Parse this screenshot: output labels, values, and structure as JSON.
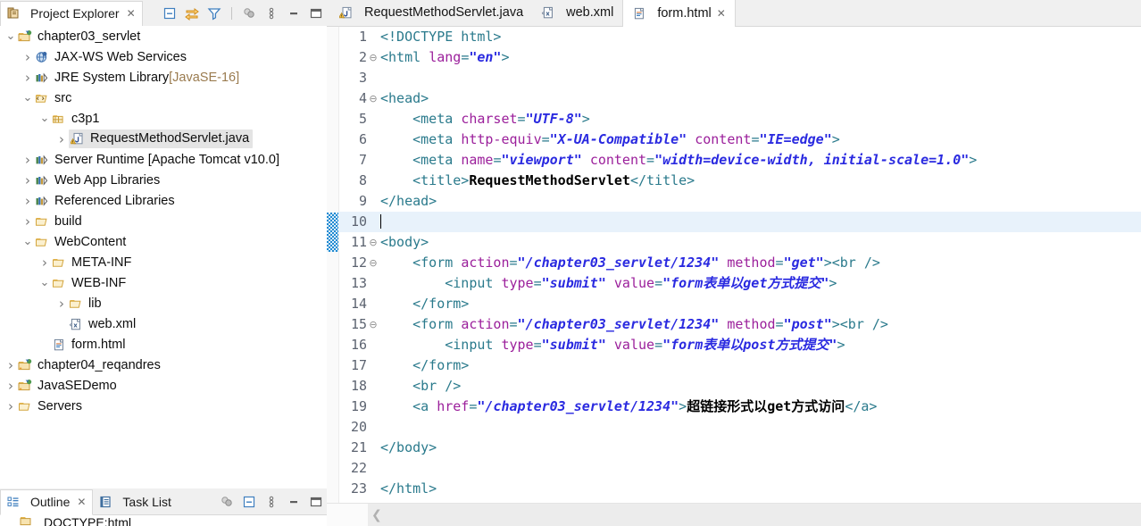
{
  "explorer": {
    "tab_label": "Project Explorer",
    "tab_close": "✕",
    "toolbar": [
      {
        "name": "collapse-all-icon",
        "title": "Collapse All"
      },
      {
        "name": "link-with-editor-icon",
        "title": "Link with Editor"
      },
      {
        "name": "filter-icon",
        "title": "Filters"
      },
      {
        "name": "view-menu-icon",
        "title": "View Menu"
      },
      {
        "name": "vertical-dots-icon",
        "title": "More"
      },
      {
        "name": "minimize-icon",
        "title": "Minimize"
      },
      {
        "name": "maximize-icon",
        "title": "Maximize"
      }
    ],
    "tree": [
      {
        "label": "chapter03_servlet",
        "indent": 0,
        "arrow": "v",
        "icon": "project-icon",
        "selected": false,
        "suffix": ""
      },
      {
        "label": "JAX-WS Web Services",
        "indent": 1,
        "arrow": ">",
        "icon": "jaxws-icon",
        "selected": false,
        "suffix": ""
      },
      {
        "label": "JRE System Library",
        "indent": 1,
        "arrow": ">",
        "icon": "library-icon",
        "selected": false,
        "suffix": " [JavaSE-16]"
      },
      {
        "label": "src",
        "indent": 1,
        "arrow": "v",
        "icon": "source-folder-icon",
        "selected": false,
        "suffix": ""
      },
      {
        "label": "c3p1",
        "indent": 2,
        "arrow": "v",
        "icon": "package-icon",
        "selected": false,
        "suffix": ""
      },
      {
        "label": "RequestMethodServlet.java",
        "indent": 3,
        "arrow": ">",
        "icon": "java-file-icon",
        "selected": true,
        "suffix": ""
      },
      {
        "label": "Server Runtime [Apache Tomcat v10.0]",
        "indent": 1,
        "arrow": ">",
        "icon": "library-icon",
        "selected": false,
        "suffix": ""
      },
      {
        "label": "Web App Libraries",
        "indent": 1,
        "arrow": ">",
        "icon": "library-icon",
        "selected": false,
        "suffix": ""
      },
      {
        "label": "Referenced Libraries",
        "indent": 1,
        "arrow": ">",
        "icon": "library-icon",
        "selected": false,
        "suffix": ""
      },
      {
        "label": "build",
        "indent": 1,
        "arrow": ">",
        "icon": "folder-icon",
        "selected": false,
        "suffix": ""
      },
      {
        "label": "WebContent",
        "indent": 1,
        "arrow": "v",
        "icon": "folder-icon",
        "selected": false,
        "suffix": ""
      },
      {
        "label": "META-INF",
        "indent": 2,
        "arrow": ">",
        "icon": "folder-icon",
        "selected": false,
        "suffix": ""
      },
      {
        "label": "WEB-INF",
        "indent": 2,
        "arrow": "v",
        "icon": "folder-icon",
        "selected": false,
        "suffix": ""
      },
      {
        "label": "lib",
        "indent": 3,
        "arrow": ">",
        "icon": "folder-icon",
        "selected": false,
        "suffix": ""
      },
      {
        "label": "web.xml",
        "indent": 3,
        "arrow": "",
        "icon": "xml-file-icon",
        "selected": false,
        "suffix": ""
      },
      {
        "label": "form.html",
        "indent": 2,
        "arrow": "",
        "icon": "html-file-icon",
        "selected": false,
        "suffix": ""
      },
      {
        "label": "chapter04_reqandres",
        "indent": 0,
        "arrow": ">",
        "icon": "project-icon",
        "selected": false,
        "suffix": ""
      },
      {
        "label": "JavaSEDemo",
        "indent": 0,
        "arrow": ">",
        "icon": "project-icon",
        "selected": false,
        "suffix": ""
      },
      {
        "label": "Servers",
        "indent": 0,
        "arrow": ">",
        "icon": "folder-icon",
        "selected": false,
        "suffix": ""
      }
    ]
  },
  "bottom_view": {
    "tabs": [
      {
        "label": "Outline",
        "icon": "outline-icon",
        "active": true,
        "close": "✕"
      },
      {
        "label": "Task List",
        "icon": "tasklist-icon",
        "active": false,
        "close": ""
      }
    ],
    "toolbar": [
      {
        "name": "view-menu-icon"
      },
      {
        "name": "collapse-all-icon"
      },
      {
        "name": "vertical-dots-icon"
      },
      {
        "name": "minimize-icon"
      },
      {
        "name": "maximize-icon"
      }
    ],
    "first_item": "DOCTYPE:html"
  },
  "editor": {
    "tabs": [
      {
        "label": "RequestMethodServlet.java",
        "icon": "java-file-icon",
        "active": false,
        "close": ""
      },
      {
        "label": "web.xml",
        "icon": "xml-file-icon",
        "active": false,
        "close": ""
      },
      {
        "label": "form.html",
        "icon": "html-file-icon",
        "active": true,
        "close": "✕"
      }
    ],
    "current_line": 10,
    "scroll_left_arrow": "❮",
    "lines": [
      {
        "n": 1,
        "fold": "",
        "html": "<span class='tag'>&lt;!DOCTYPE html&gt;</span>"
      },
      {
        "n": 2,
        "fold": "⊖",
        "html": "<span class='tag'>&lt;html </span><span class='attr'>lang</span><span class='tag'>=</span><span class='val'>\"en\"</span><span class='tag'>&gt;</span>"
      },
      {
        "n": 3,
        "fold": "",
        "html": ""
      },
      {
        "n": 4,
        "fold": "⊖",
        "html": "<span class='tag'>&lt;head&gt;</span>"
      },
      {
        "n": 5,
        "fold": "",
        "html": "    <span class='tag'>&lt;meta </span><span class='attr'>charset</span><span class='tag'>=</span><span class='val'>\"UTF-8\"</span><span class='tag'>&gt;</span>"
      },
      {
        "n": 6,
        "fold": "",
        "html": "    <span class='tag'>&lt;meta </span><span class='attr'>http-equiv</span><span class='tag'>=</span><span class='val'>\"X-UA-Compatible\"</span><span class='tag'> </span><span class='attr'>content</span><span class='tag'>=</span><span class='val'>\"IE=edge\"</span><span class='tag'>&gt;</span>"
      },
      {
        "n": 7,
        "fold": "",
        "html": "    <span class='tag'>&lt;meta </span><span class='attr'>name</span><span class='tag'>=</span><span class='val'>\"viewport\"</span><span class='tag'> </span><span class='attr'>content</span><span class='tag'>=</span><span class='val'>\"width=device-width, initial-scale=1.0\"</span><span class='tag'>&gt;</span>"
      },
      {
        "n": 8,
        "fold": "",
        "html": "    <span class='tag'>&lt;title&gt;</span><span class='txt'>RequestMethodServlet</span><span class='tag'>&lt;/title&gt;</span>"
      },
      {
        "n": 9,
        "fold": "",
        "html": "<span class='tag'>&lt;/head&gt;</span>"
      },
      {
        "n": 10,
        "fold": "",
        "html": "<span class='caret'></span>"
      },
      {
        "n": 11,
        "fold": "⊖",
        "html": "<span class='tag'>&lt;body&gt;</span>"
      },
      {
        "n": 12,
        "fold": "⊖",
        "html": "    <span class='tag'>&lt;form </span><span class='attr'>action</span><span class='tag'>=</span><span class='val'>\"/chapter03_servlet/1234\"</span><span class='tag'> </span><span class='attr'>method</span><span class='tag'>=</span><span class='val'>\"get\"</span><span class='tag'>&gt;&lt;br /&gt;</span>"
      },
      {
        "n": 13,
        "fold": "",
        "html": "        <span class='tag'>&lt;input </span><span class='attr'>type</span><span class='tag'>=</span><span class='val'>\"submit\"</span><span class='tag'> </span><span class='attr'>value</span><span class='tag'>=</span><span class='val'>\"form<span class='cjk'>表单以</span>get<span class='cjk'>方式提交</span>\"</span><span class='tag'>&gt;</span>"
      },
      {
        "n": 14,
        "fold": "",
        "html": "    <span class='tag'>&lt;/form&gt;</span>"
      },
      {
        "n": 15,
        "fold": "⊖",
        "html": "    <span class='tag'>&lt;form </span><span class='attr'>action</span><span class='tag'>=</span><span class='val'>\"/chapter03_servlet/1234\"</span><span class='tag'> </span><span class='attr'>method</span><span class='tag'>=</span><span class='val'>\"post\"</span><span class='tag'>&gt;&lt;br /&gt;</span>"
      },
      {
        "n": 16,
        "fold": "",
        "html": "        <span class='tag'>&lt;input </span><span class='attr'>type</span><span class='tag'>=</span><span class='val'>\"submit\"</span><span class='tag'> </span><span class='attr'>value</span><span class='tag'>=</span><span class='val'>\"form<span class='cjk'>表单以</span>post<span class='cjk'>方式提交</span>\"</span><span class='tag'>&gt;</span>"
      },
      {
        "n": 17,
        "fold": "",
        "html": "    <span class='tag'>&lt;/form&gt;</span>"
      },
      {
        "n": 18,
        "fold": "",
        "html": "    <span class='tag'>&lt;br /&gt;</span>"
      },
      {
        "n": 19,
        "fold": "",
        "html": "    <span class='tag'>&lt;a </span><span class='attr'>href</span><span class='tag'>=</span><span class='val'>\"/chapter03_servlet/1234\"</span><span class='tag'>&gt;</span><span class='txt cjk'>超链接形式以</span><span class='txt'>get</span><span class='txt cjk'>方式访问</span><span class='tag'>&lt;/a&gt;</span>"
      },
      {
        "n": 20,
        "fold": "",
        "html": ""
      },
      {
        "n": 21,
        "fold": "",
        "html": "<span class='tag'>&lt;/body&gt;</span>"
      },
      {
        "n": 22,
        "fold": "",
        "html": ""
      },
      {
        "n": 23,
        "fold": "",
        "html": "<span class='tag'>&lt;/html&gt;</span>"
      }
    ]
  },
  "colors": {
    "tag": "#2a7a8c",
    "attribute": "#9b1f9b",
    "value": "#2a2ae0",
    "text": "#000000",
    "current_line_bg": "#e8f2fb",
    "selection_bg": "#e4e4e4",
    "chrome_bg": "#f0f0f0"
  }
}
